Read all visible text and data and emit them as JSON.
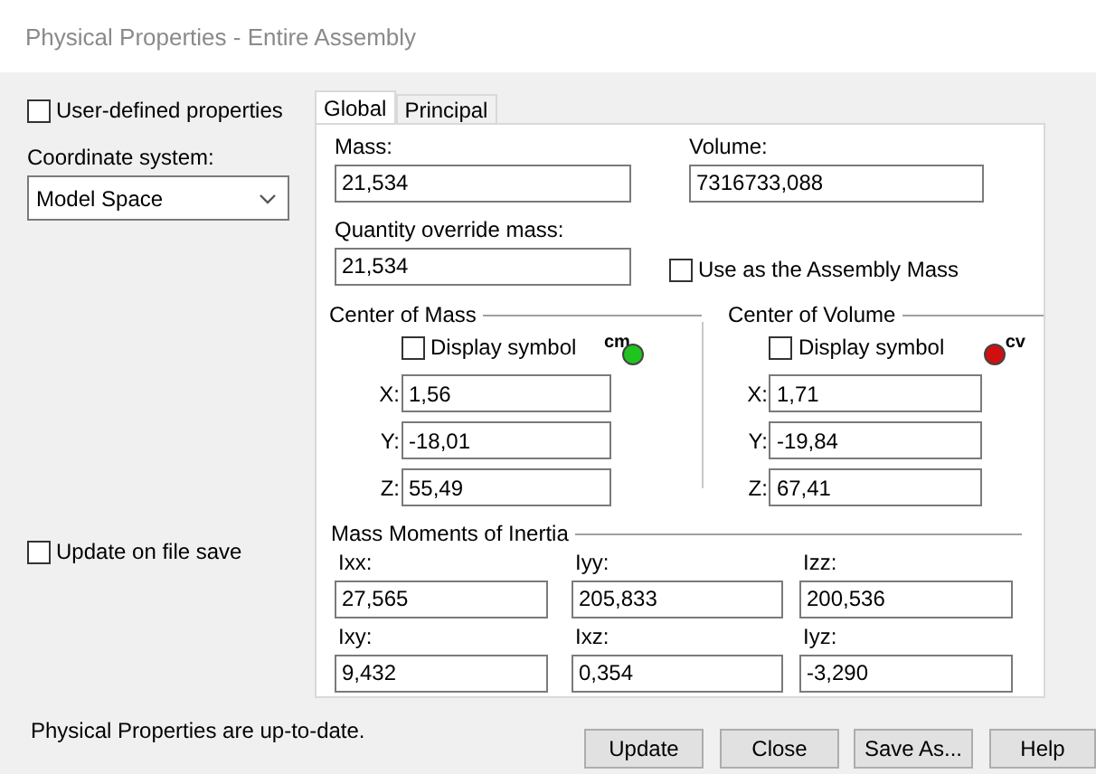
{
  "window": {
    "title": "Physical Properties - Entire Assembly"
  },
  "user_defined": {
    "label": "User-defined properties",
    "checked": false
  },
  "coordinate_system": {
    "label": "Coordinate system:",
    "value": "Model Space"
  },
  "update_on_save": {
    "label": "Update on file save",
    "checked": false
  },
  "tabs": [
    {
      "label": "Global",
      "selected": true
    },
    {
      "label": "Principal",
      "selected": false
    }
  ],
  "mass": {
    "label": "Mass:",
    "value": "21,534"
  },
  "volume": {
    "label": "Volume:",
    "value": "7316733,088"
  },
  "quantity_override": {
    "label": "Quantity override mass:",
    "value": "21,534"
  },
  "use_as_assembly_mass": {
    "label": "Use as the Assembly Mass",
    "checked": false
  },
  "centers": [
    {
      "title": "Center of Mass",
      "display_symbol": {
        "label": "Display symbol",
        "checked": false
      },
      "symbol": {
        "label": "cm",
        "color": "#1fc41f"
      },
      "coords": [
        {
          "axis": "X:",
          "value": "1,56"
        },
        {
          "axis": "Y:",
          "value": "-18,01"
        },
        {
          "axis": "Z:",
          "value": "55,49"
        }
      ]
    },
    {
      "title": "Center of Volume",
      "display_symbol": {
        "label": "Display symbol",
        "checked": false
      },
      "symbol": {
        "label": "cv",
        "color": "#d01010"
      },
      "coords": [
        {
          "axis": "X:",
          "value": "1,71"
        },
        {
          "axis": "Y:",
          "value": "-19,84"
        },
        {
          "axis": "Z:",
          "value": "67,41"
        }
      ]
    }
  ],
  "inertia": {
    "title": "Mass Moments of Inertia",
    "fields": [
      {
        "label": "Ixx:",
        "value": "27,565"
      },
      {
        "label": "Iyy:",
        "value": "205,833"
      },
      {
        "label": "Izz:",
        "value": "200,536"
      },
      {
        "label": "Ixy:",
        "value": "9,432"
      },
      {
        "label": "Ixz:",
        "value": "0,354"
      },
      {
        "label": "Iyz:",
        "value": "-3,290"
      }
    ]
  },
  "status": "Physical Properties are up-to-date.",
  "buttons": [
    "Update",
    "Close",
    "Save As...",
    "Help"
  ]
}
